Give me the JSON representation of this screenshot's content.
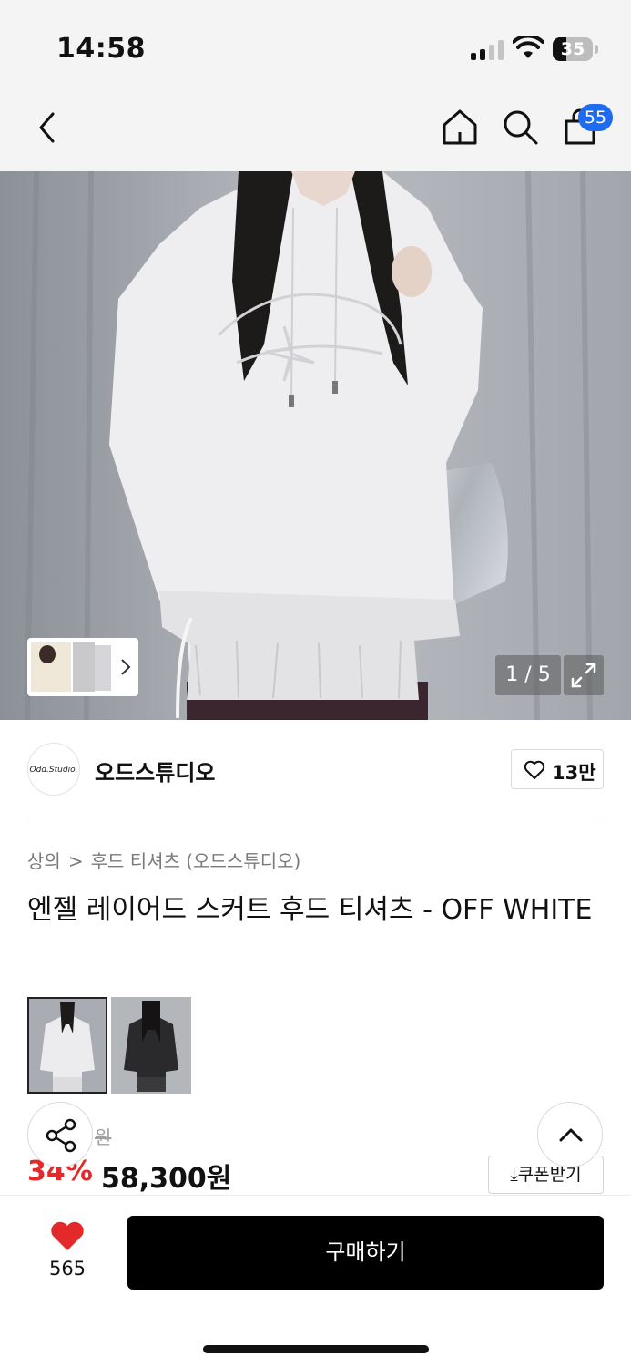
{
  "status_bar": {
    "time": "14:58",
    "battery": "35",
    "battery_level_percent": 35
  },
  "nav": {
    "cart_count": "55",
    "icons": [
      "back-icon",
      "home-icon",
      "search-icon",
      "cart-icon"
    ]
  },
  "gallery": {
    "counter": "1 / 5"
  },
  "brand": {
    "name": "오드스튜디오",
    "logo_text": "Odd.Studio.",
    "likes": "13만"
  },
  "breadcrumb": {
    "category": "상의",
    "separator": ">",
    "subcategory": "후드 티셔츠 (오드스튜디오)"
  },
  "product": {
    "title": "엔젤 레이어드 스커트 후드 티셔츠 - OFF WHITE",
    "colors": [
      {
        "name": "off-white",
        "swatch": "#dcdcdc"
      },
      {
        "name": "black",
        "swatch": "#2a2a2a"
      }
    ]
  },
  "price": {
    "original_visible": "원",
    "discount": "34%",
    "sale": "58,300원",
    "coupon_label": "쿠폰받기"
  },
  "bottom": {
    "wish_count": "565",
    "buy_label": "구매하기"
  },
  "colors": {
    "accent_red": "#e4292b",
    "badge_blue": "#1e6bf0",
    "buy_button": "#000000"
  }
}
